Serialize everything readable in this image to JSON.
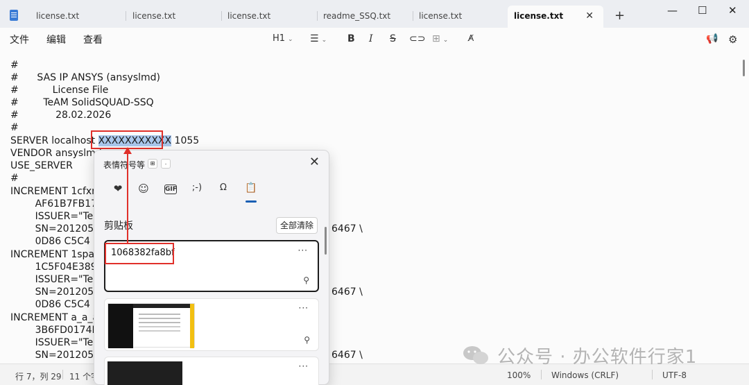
{
  "tabs": [
    {
      "label": "license.txt",
      "active": false
    },
    {
      "label": "license.txt",
      "active": false
    },
    {
      "label": "license.txt",
      "active": false
    },
    {
      "label": "readme_SSQ.txt",
      "active": false
    },
    {
      "label": "license.txt",
      "active": false
    },
    {
      "label": "license.txt",
      "active": true
    }
  ],
  "window": {
    "close_tab": "✕",
    "new_tab": "+",
    "minimize": "—",
    "maximize": "☐",
    "close": "✕"
  },
  "menu": {
    "file": "文件",
    "edit": "编辑",
    "view": "查看"
  },
  "toolbar": {
    "heading": "H1",
    "bold": "B",
    "italic": "I",
    "strike": "S"
  },
  "editor": {
    "lines": [
      "#",
      "#      SAS IP ANSYS (ansyslmd)",
      "#           License File",
      "#        TeAM SolidSQUAD-SSQ",
      "#            28.02.2026",
      "#",
      "SERVER localhost ",
      "VENDOR ansyslmd",
      "USE_SERVER",
      "#",
      "INCREMENT 1cfxm",
      "        AF61B7FB175",
      "        ISSUER=\"Tean",
      "        SN=20120530",
      "        0D86 C5C4 C7",
      "INCREMENT 1spac",
      "        1C5F04E389E",
      "        ISSUER=\"Tean",
      "        SN=20120530",
      "        0D86 C5C4 C7",
      "INCREMENT a_a_a",
      "        3B6FD0174FF",
      "        ISSUER=\"Tean",
      "        SN=20120530"
    ],
    "selected_text": "XXXXXXXXXXX",
    "server_port": " 1055",
    "right_fragments": [
      "6467 \\",
      "6467 \\",
      "6467 \\"
    ]
  },
  "status": {
    "position": "行 7，列 29",
    "chars": "11 个字",
    "zoom": "100%",
    "line_ending": "Windows (CRLF)",
    "encoding": "UTF-8"
  },
  "panel": {
    "title": "表情符号等",
    "kb1": "⊞",
    "kb2": ".",
    "close": "✕",
    "categories": [
      "❤",
      "☺",
      "GIF",
      ";-)",
      "Ω",
      "📋"
    ],
    "clipboard_heading": "剪贴板",
    "clear_all": "全部清除",
    "items": [
      {
        "text": "1068382fa8bf"
      }
    ],
    "dots": "···",
    "pin": "📌"
  },
  "watermark": "公众号 · 办公软件行家1"
}
